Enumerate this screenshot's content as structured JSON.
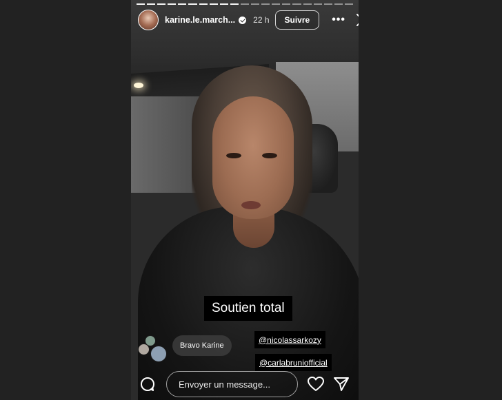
{
  "story": {
    "progress": {
      "segments_total": 21,
      "segments_done": 10
    },
    "header": {
      "username": "karine.le.march...",
      "time": "22 h",
      "follow_label": "Suivre",
      "verified_icon": "verified-badge-icon",
      "more_icon": "more-icon",
      "more_glyph": "•••",
      "close_icon": "close-icon"
    },
    "caption": "Soutien total",
    "mentions": [
      "@nicolassarkozy",
      "@carlabruniofficial"
    ],
    "reply_chip": "Bravo Karine",
    "bottom_bar": {
      "message_placeholder": "Envoyer un message...",
      "camera_icon": "camera-icon",
      "heart_icon": "heart-icon",
      "send_icon": "send-icon"
    }
  },
  "colors": {
    "page_background": "#222222",
    "text": "#ffffff",
    "sticker_background": "#000000"
  }
}
